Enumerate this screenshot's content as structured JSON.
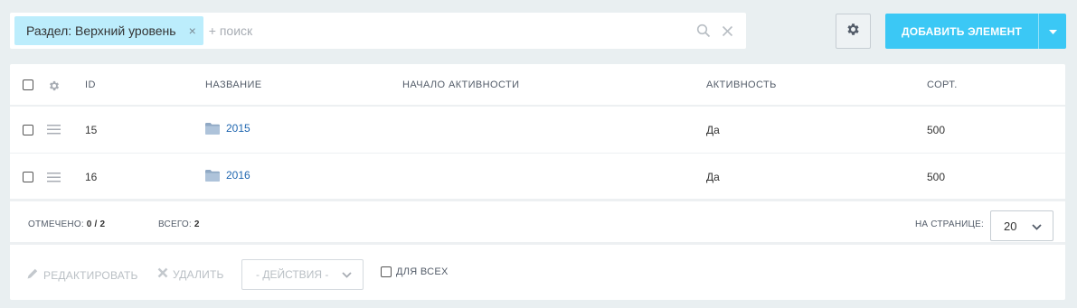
{
  "filter": {
    "tag_label": "Раздел: Верхний уровень",
    "tag_close": "×",
    "search_placeholder": "+ поиск"
  },
  "toolbar": {
    "add_label": "ДОБАВИТЬ ЭЛЕМЕНТ"
  },
  "table": {
    "headers": {
      "id": "ID",
      "name": "НАЗВАНИЕ",
      "active_from": "НАЧАЛО АКТИВНОСТИ",
      "active": "АКТИВНОСТЬ",
      "sort": "СОРТ."
    },
    "rows": [
      {
        "id": "15",
        "name": "2015",
        "active_from": "",
        "active": "Да",
        "sort": "500"
      },
      {
        "id": "16",
        "name": "2016",
        "active_from": "",
        "active": "Да",
        "sort": "500"
      }
    ]
  },
  "summary": {
    "selected_label": "ОТМЕЧЕНО:",
    "selected_value": "0 / 2",
    "total_label": "ВСЕГО:",
    "total_value": "2",
    "per_page_label": "НА СТРАНИЦЕ:",
    "per_page_value": "20"
  },
  "actions": {
    "edit_label": "РЕДАКТИРОВАТЬ",
    "delete_label": "УДАЛИТЬ",
    "select_label": "- ДЕЙСТВИЯ -",
    "for_all_label": "ДЛЯ ВСЕХ"
  },
  "icons": {
    "search": "search-icon",
    "clear": "clear-icon",
    "settings": "gear-icon",
    "dropdown": "chevron-down-icon",
    "drag": "drag-handle-icon",
    "folder": "folder-icon",
    "edit": "pencil-icon",
    "delete": "close-icon"
  },
  "colors": {
    "accent": "#3bc8f5",
    "tag_bg": "#bcedfc",
    "link": "#2067b0",
    "page_bg": "#e9eff1"
  }
}
